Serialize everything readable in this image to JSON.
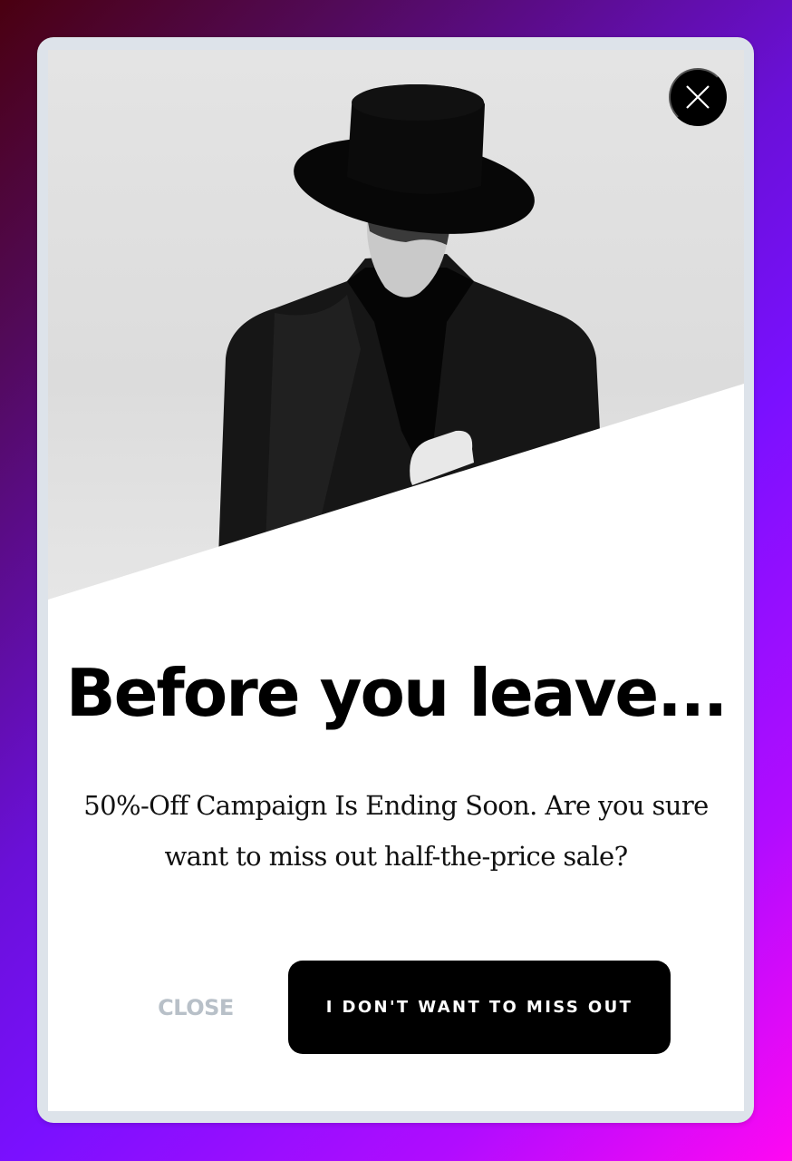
{
  "popup": {
    "image_alt": "Man in black wide-brim hat and black coat",
    "close_icon": "close-x-icon",
    "headline": "Before you leave...",
    "message": "50%-Off Campaign Is Ending Soon. Are you sure want to miss out half-the-price sale?",
    "buttons": {
      "close_label": "CLOSE",
      "cta_label": "I DON'T WANT TO MISS OUT"
    },
    "colors": {
      "cta_background": "#000000",
      "cta_text": "#ffffff",
      "close_text": "#b8c0c8",
      "background_gradient_start": "#4a0010",
      "background_gradient_mid": "#7a10ff",
      "background_gradient_end": "#ff08f2"
    }
  }
}
